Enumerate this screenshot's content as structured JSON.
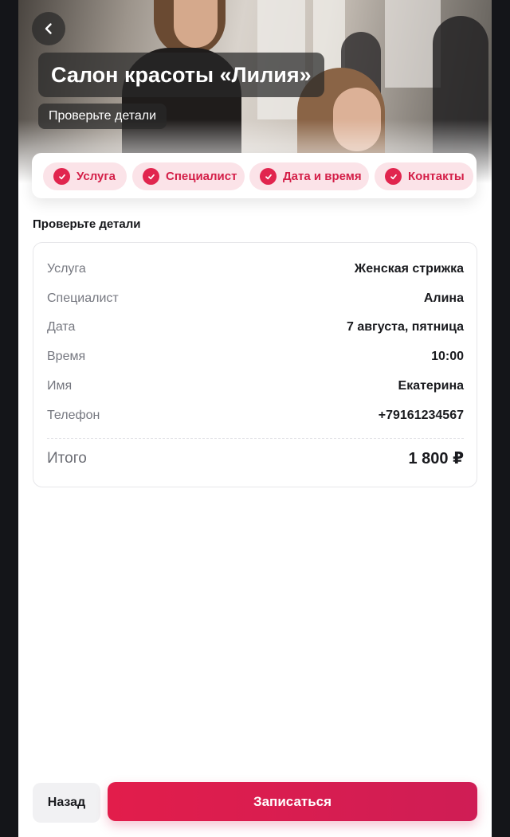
{
  "header": {
    "title": "Салон красоты «Лилия»",
    "subtitle": "Проверьте детали"
  },
  "steps": [
    {
      "label": "Услуга",
      "done": true
    },
    {
      "label": "Специалист",
      "done": true
    },
    {
      "label": "Дата и время",
      "done": true
    },
    {
      "label": "Контакты",
      "done": true
    }
  ],
  "summary": {
    "title": "Проверьте детали",
    "rows": [
      {
        "label": "Услуга",
        "value": "Женская стрижка"
      },
      {
        "label": "Специалист",
        "value": "Алина"
      },
      {
        "label": "Дата",
        "value": "7 августа, пятница"
      },
      {
        "label": "Время",
        "value": "10:00"
      },
      {
        "label": "Имя",
        "value": "Екатерина"
      },
      {
        "label": "Телефон",
        "value": "+79161234567"
      }
    ],
    "total_label": "Итого",
    "total_value": "1 800 ₽"
  },
  "actions": {
    "back_label": "Назад",
    "submit_label": "Записаться"
  },
  "colors": {
    "accent": "#e1254e",
    "step_bg": "#fbe3e8"
  }
}
